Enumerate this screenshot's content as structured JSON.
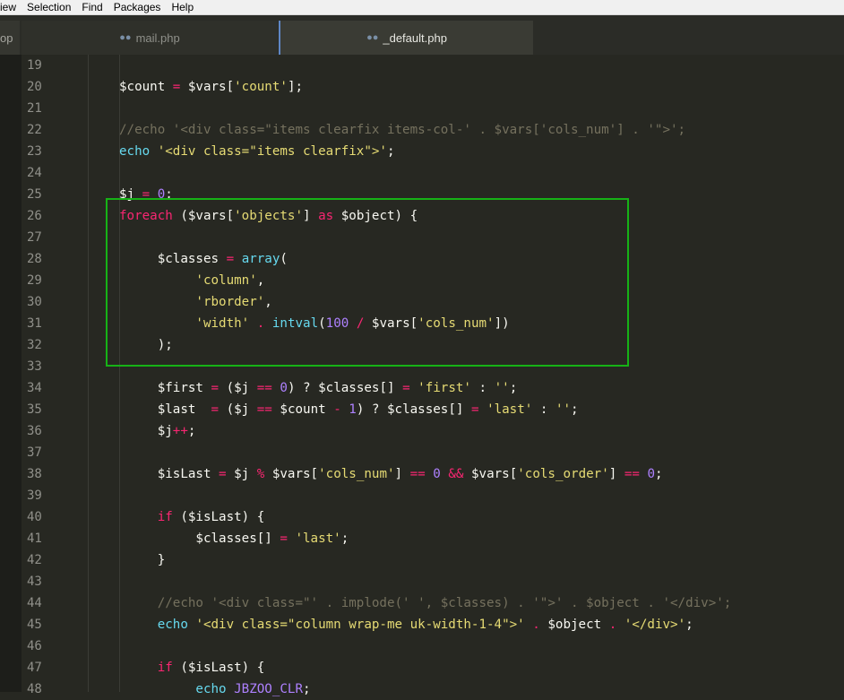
{
  "menu": [
    "iew",
    "Selection",
    "Find",
    "Packages",
    "Help"
  ],
  "tabs": [
    {
      "label": "op",
      "icon": "php-elephant-icon"
    },
    {
      "label": "mail.php",
      "icon": "php-elephant-icon"
    },
    {
      "label": "_default.php",
      "icon": "php-elephant-icon",
      "active": true
    }
  ],
  "colors": {
    "background": "#272822",
    "keyword": "#f92672",
    "function": "#66d9ef",
    "string": "#e6db74",
    "number": "#ae81ff",
    "comment": "#75715e",
    "highlight_box": "#16b216"
  },
  "lines": [
    {
      "n": "19",
      "tokens": []
    },
    {
      "n": "20",
      "tokens": [
        [
          "",
          "$count "
        ],
        [
          "kw",
          "="
        ],
        [
          "",
          " $vars["
        ],
        [
          "st",
          "'count'"
        ],
        [
          "",
          "];"
        ]
      ]
    },
    {
      "n": "21",
      "tokens": []
    },
    {
      "n": "22",
      "tokens": [
        [
          "cm",
          "//echo '<div class=\"items clearfix items-col-' . $vars['cols_num'] . '\">';"
        ]
      ]
    },
    {
      "n": "23",
      "tokens": [
        [
          "fn",
          "echo"
        ],
        [
          "",
          " "
        ],
        [
          "st",
          "'<div class=\"items clearfix\">'"
        ],
        [
          "",
          ";"
        ]
      ]
    },
    {
      "n": "24",
      "tokens": []
    },
    {
      "n": "25",
      "tokens": [
        [
          "",
          "$j "
        ],
        [
          "kw",
          "="
        ],
        [
          "",
          " "
        ],
        [
          "nu",
          "0"
        ],
        [
          "",
          ";"
        ]
      ]
    },
    {
      "n": "26",
      "tokens": [
        [
          "kw",
          "foreach"
        ],
        [
          "",
          " ($vars["
        ],
        [
          "st",
          "'objects'"
        ],
        [
          "",
          "] "
        ],
        [
          "kw",
          "as"
        ],
        [
          "",
          " $object) {"
        ]
      ]
    },
    {
      "n": "27",
      "tokens": []
    },
    {
      "n": "28",
      "tokens": [
        [
          "",
          "     $classes "
        ],
        [
          "kw",
          "="
        ],
        [
          "",
          " "
        ],
        [
          "fn",
          "array"
        ],
        [
          "",
          "("
        ]
      ]
    },
    {
      "n": "29",
      "tokens": [
        [
          "",
          "          "
        ],
        [
          "st",
          "'column'"
        ],
        [
          "",
          ","
        ]
      ]
    },
    {
      "n": "30",
      "tokens": [
        [
          "",
          "          "
        ],
        [
          "st",
          "'rborder'"
        ],
        [
          "",
          ","
        ]
      ]
    },
    {
      "n": "31",
      "tokens": [
        [
          "",
          "          "
        ],
        [
          "st",
          "'width'"
        ],
        [
          "",
          " "
        ],
        [
          "kw",
          "."
        ],
        [
          "",
          " "
        ],
        [
          "fn",
          "intval"
        ],
        [
          "",
          "("
        ],
        [
          "nu",
          "100"
        ],
        [
          "",
          " "
        ],
        [
          "kw",
          "/"
        ],
        [
          "",
          " $vars["
        ],
        [
          "st",
          "'cols_num'"
        ],
        [
          "",
          "])"
        ]
      ]
    },
    {
      "n": "32",
      "tokens": [
        [
          "",
          "     );"
        ]
      ]
    },
    {
      "n": "33",
      "tokens": []
    },
    {
      "n": "34",
      "tokens": [
        [
          "",
          "     $first "
        ],
        [
          "kw",
          "="
        ],
        [
          "",
          " ($j "
        ],
        [
          "kw",
          "=="
        ],
        [
          "",
          " "
        ],
        [
          "nu",
          "0"
        ],
        [
          "",
          ") ? $classes[] "
        ],
        [
          "kw",
          "="
        ],
        [
          "",
          " "
        ],
        [
          "st",
          "'first'"
        ],
        [
          "",
          " : "
        ],
        [
          "st",
          "''"
        ],
        [
          "",
          ";"
        ]
      ]
    },
    {
      "n": "35",
      "tokens": [
        [
          "",
          "     $last  "
        ],
        [
          "kw",
          "="
        ],
        [
          "",
          " ($j "
        ],
        [
          "kw",
          "=="
        ],
        [
          "",
          " $count "
        ],
        [
          "kw",
          "-"
        ],
        [
          "",
          " "
        ],
        [
          "nu",
          "1"
        ],
        [
          "",
          ") ? $classes[] "
        ],
        [
          "kw",
          "="
        ],
        [
          "",
          " "
        ],
        [
          "st",
          "'last'"
        ],
        [
          "",
          " : "
        ],
        [
          "st",
          "''"
        ],
        [
          "",
          ";"
        ]
      ]
    },
    {
      "n": "36",
      "tokens": [
        [
          "",
          "     $j"
        ],
        [
          "kw",
          "++"
        ],
        [
          "",
          ";"
        ]
      ]
    },
    {
      "n": "37",
      "tokens": []
    },
    {
      "n": "38",
      "tokens": [
        [
          "",
          "     $isLast "
        ],
        [
          "kw",
          "="
        ],
        [
          "",
          " $j "
        ],
        [
          "kw",
          "%"
        ],
        [
          "",
          " $vars["
        ],
        [
          "st",
          "'cols_num'"
        ],
        [
          "",
          "] "
        ],
        [
          "kw",
          "=="
        ],
        [
          "",
          " "
        ],
        [
          "nu",
          "0"
        ],
        [
          "",
          " "
        ],
        [
          "kw",
          "&&"
        ],
        [
          "",
          " $vars["
        ],
        [
          "st",
          "'cols_order'"
        ],
        [
          "",
          "] "
        ],
        [
          "kw",
          "=="
        ],
        [
          "",
          " "
        ],
        [
          "nu",
          "0"
        ],
        [
          "",
          ";"
        ]
      ]
    },
    {
      "n": "39",
      "tokens": []
    },
    {
      "n": "40",
      "tokens": [
        [
          "",
          "     "
        ],
        [
          "kw",
          "if"
        ],
        [
          "",
          " ($isLast) {"
        ]
      ]
    },
    {
      "n": "41",
      "tokens": [
        [
          "",
          "          $classes[] "
        ],
        [
          "kw",
          "="
        ],
        [
          "",
          " "
        ],
        [
          "st",
          "'last'"
        ],
        [
          "",
          ";"
        ]
      ]
    },
    {
      "n": "42",
      "tokens": [
        [
          "",
          "     }"
        ]
      ]
    },
    {
      "n": "43",
      "tokens": []
    },
    {
      "n": "44",
      "tokens": [
        [
          "cm",
          "     //echo '<div class=\"' . implode(' ', $classes) . '\">' . $object . '</div>';"
        ]
      ]
    },
    {
      "n": "45",
      "tokens": [
        [
          "",
          "     "
        ],
        [
          "fn",
          "echo"
        ],
        [
          "",
          " "
        ],
        [
          "st",
          "'<div class=\"column wrap-me uk-width-1-4\">'"
        ],
        [
          "",
          " "
        ],
        [
          "kw",
          "."
        ],
        [
          "",
          " $object "
        ],
        [
          "kw",
          "."
        ],
        [
          "",
          " "
        ],
        [
          "st",
          "'</div>'"
        ],
        [
          "",
          ";"
        ]
      ]
    },
    {
      "n": "46",
      "tokens": []
    },
    {
      "n": "47",
      "tokens": [
        [
          "",
          "     "
        ],
        [
          "kw",
          "if"
        ],
        [
          "",
          " ($isLast) {"
        ]
      ]
    },
    {
      "n": "48",
      "tokens": [
        [
          "",
          "          "
        ],
        [
          "fn",
          "echo"
        ],
        [
          "",
          " "
        ],
        [
          "nu",
          "JBZOO_CLR"
        ],
        [
          "",
          ";"
        ]
      ]
    }
  ]
}
